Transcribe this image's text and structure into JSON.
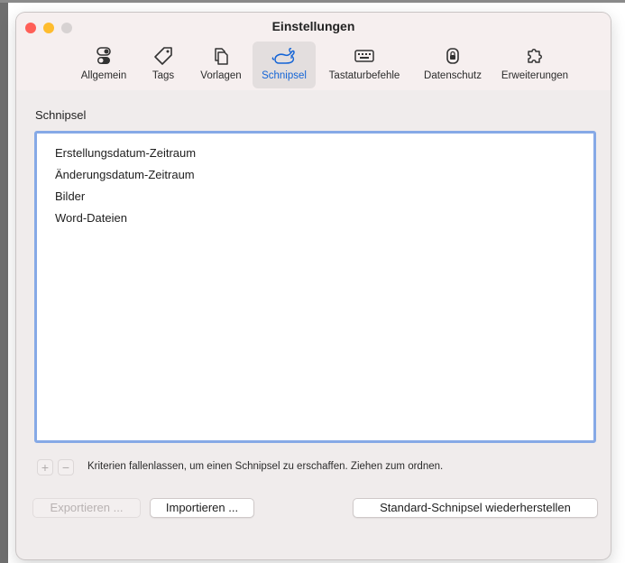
{
  "window": {
    "title": "Einstellungen"
  },
  "tabs": [
    {
      "label": "Allgemein",
      "icon": "toggle-icon"
    },
    {
      "label": "Tags",
      "icon": "tag-icon"
    },
    {
      "label": "Vorlagen",
      "icon": "documents-icon"
    },
    {
      "label": "Schnipsel",
      "icon": "rabbit-icon",
      "selected": true
    },
    {
      "label": "Tastaturbefehle",
      "icon": "keyboard-icon"
    },
    {
      "label": "Datenschutz",
      "icon": "lock-icon"
    },
    {
      "label": "Erweiterungen",
      "icon": "puzzle-icon"
    }
  ],
  "section": {
    "label": "Schnipsel"
  },
  "snippets": [
    "Erstellungsdatum-Zeitraum",
    "Änderungsdatum-Zeitraum",
    "Bilder",
    "Word-Dateien"
  ],
  "controls": {
    "add": "+",
    "remove": "−"
  },
  "hint": "Kriterien fallenlassen, um einen Schnipsel zu erschaffen. Ziehen zum ordnen.",
  "buttons": {
    "export": "Exportieren ...",
    "import": "Importieren ...",
    "restore": "Standard-Schnipsel wiederherstellen"
  },
  "colors": {
    "accent": "#1464d6",
    "list_border": "#86a9e6",
    "close": "#ff5f57",
    "minimize": "#febc2e"
  }
}
